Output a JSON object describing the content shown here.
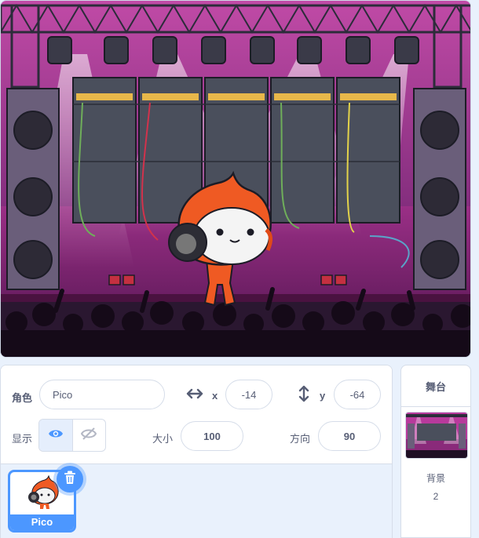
{
  "sprite_info": {
    "sprite_label": "角色",
    "sprite_name": "Pico",
    "x_label": "x",
    "x_value": "-14",
    "y_label": "y",
    "y_value": "-64",
    "show_label": "显示",
    "size_label": "大小",
    "size_value": "100",
    "direction_label": "方向",
    "direction_value": "90"
  },
  "sprites": [
    {
      "name": "Pico",
      "selected": true
    }
  ],
  "stage_panel": {
    "title": "舞台",
    "backdrops_label": "背景",
    "backdrops_count": "2"
  },
  "colors": {
    "accent": "#4c97ff",
    "stage_floor": "#8a2a7a",
    "backdrop_wall": "#b83a9c"
  },
  "icons": [
    "eye-icon",
    "eye-off-icon",
    "trash-icon",
    "horizontal-arrows-icon",
    "vertical-arrows-icon"
  ]
}
